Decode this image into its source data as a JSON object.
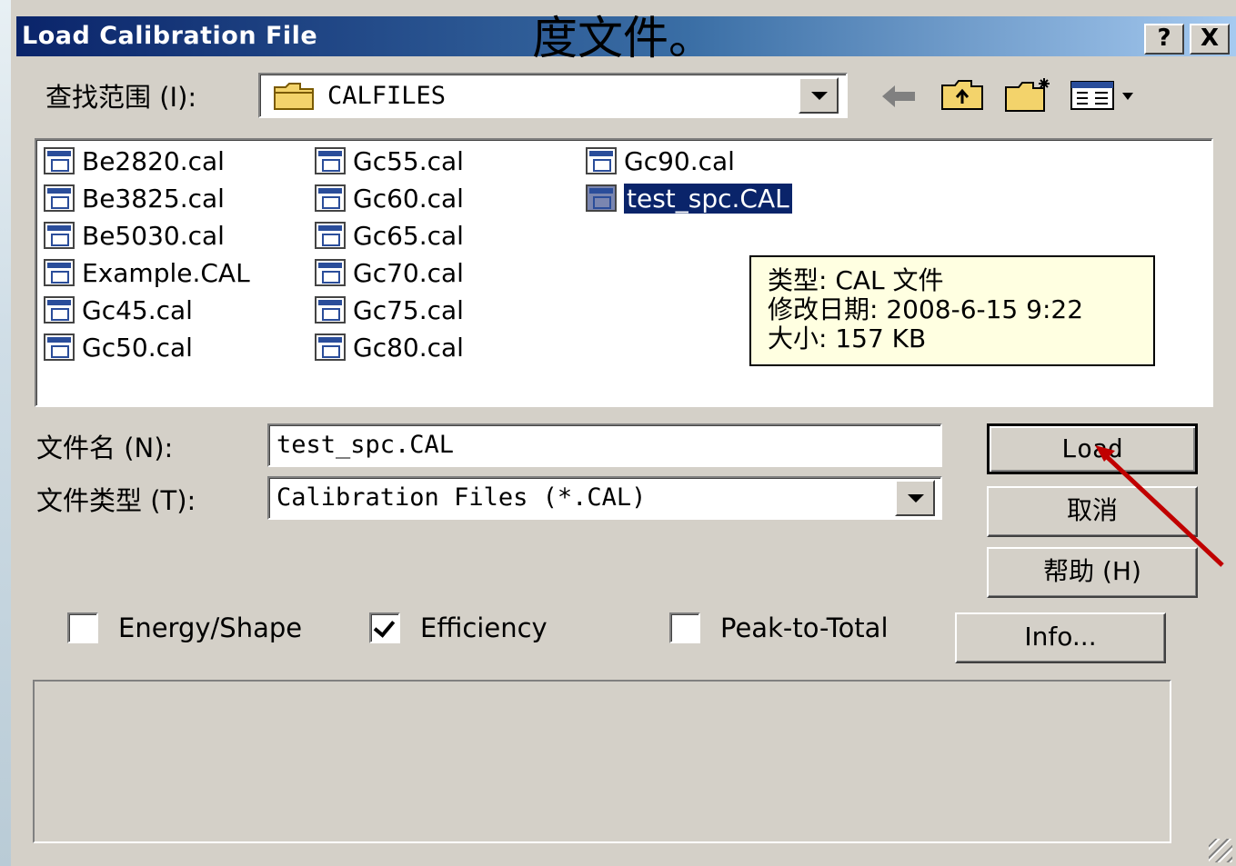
{
  "window": {
    "title": "Load Calibration File",
    "help_button": "?",
    "close_button": "X"
  },
  "overlay_caption": "度文件。",
  "look_in": {
    "label": "查找范围 (I):",
    "value": "CALFILES"
  },
  "files": [
    {
      "name": "Be2820.cal"
    },
    {
      "name": "Be3825.cal"
    },
    {
      "name": "Be5030.cal"
    },
    {
      "name": "Example.CAL"
    },
    {
      "name": "Gc45.cal"
    },
    {
      "name": "Gc50.cal"
    },
    {
      "name": "Gc55.cal"
    },
    {
      "name": "Gc60.cal"
    },
    {
      "name": "Gc65.cal"
    },
    {
      "name": "Gc70.cal"
    },
    {
      "name": "Gc75.cal"
    },
    {
      "name": "Gc80.cal"
    },
    {
      "name": "Gc90.cal"
    },
    {
      "name": "test_spc.CAL",
      "selected": true
    }
  ],
  "tooltip": {
    "type_line": "类型: CAL 文件",
    "modified_line": "修改日期: 2008-6-15 9:22",
    "size_line": "大小: 157 KB"
  },
  "file_name": {
    "label": "文件名 (N):",
    "value": "test_spc.CAL"
  },
  "file_type": {
    "label": "文件类型 (T):",
    "value": "Calibration Files (*.CAL)"
  },
  "buttons": {
    "load": "Load",
    "cancel": "取消",
    "help": "帮助 (H)",
    "info": "Info..."
  },
  "checkboxes": [
    {
      "label": "Energy/Shape",
      "checked": false
    },
    {
      "label": "Efficiency",
      "checked": true
    },
    {
      "label": "Peak-to-Total",
      "checked": false
    }
  ],
  "colors": {
    "title_start": "#0a246a",
    "title_end": "#a6caf0",
    "face": "#d4d0c8",
    "selection": "#0a246a",
    "tooltip_bg": "#ffffe1",
    "arrow": "#c00000"
  }
}
